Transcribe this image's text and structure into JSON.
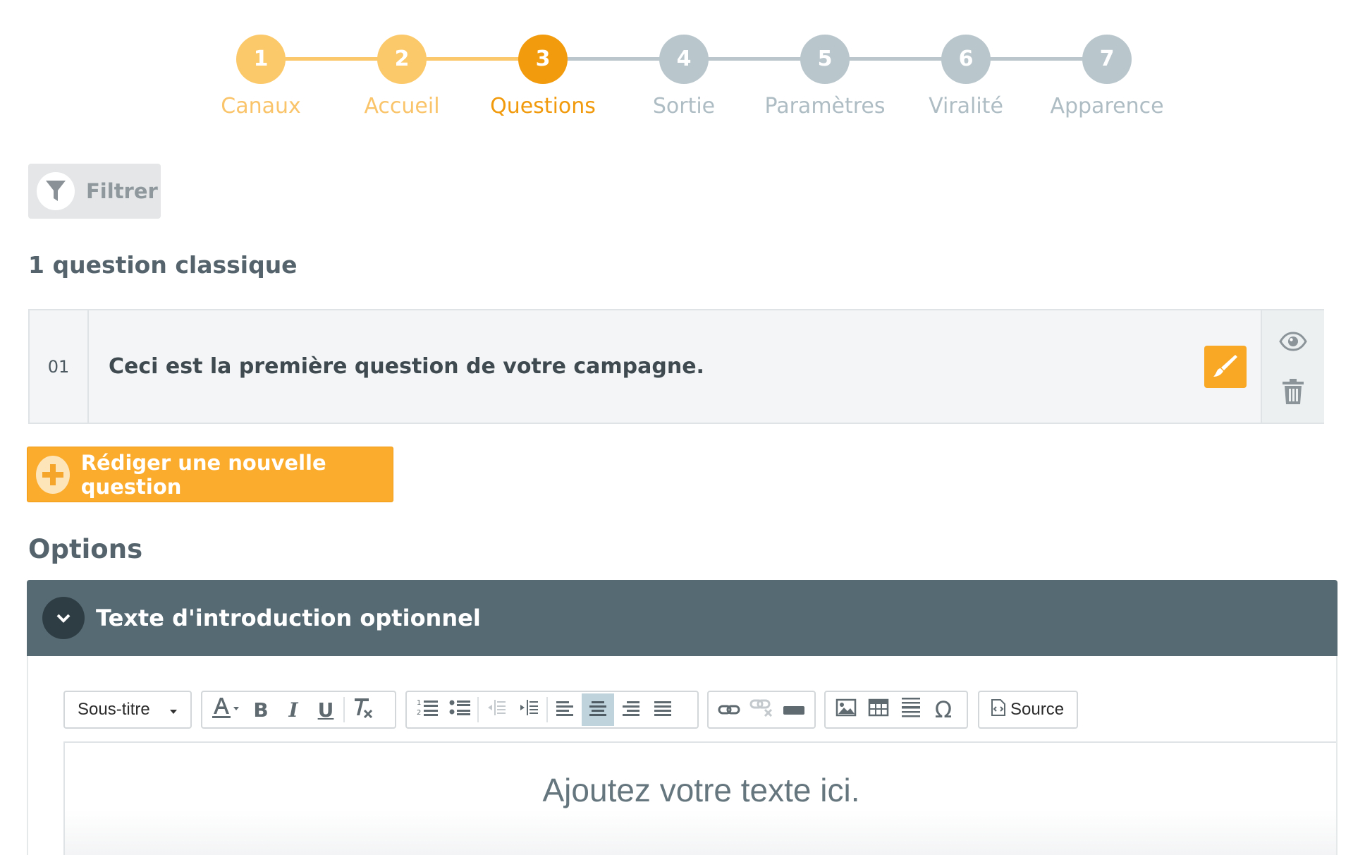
{
  "stepper": {
    "steps": [
      {
        "number": "1",
        "label": "Canaux",
        "state": "done"
      },
      {
        "number": "2",
        "label": "Accueil",
        "state": "done"
      },
      {
        "number": "3",
        "label": "Questions",
        "state": "current"
      },
      {
        "number": "4",
        "label": "Sortie",
        "state": "todo"
      },
      {
        "number": "5",
        "label": "Paramètres",
        "state": "todo"
      },
      {
        "number": "6",
        "label": "Viralité",
        "state": "todo"
      },
      {
        "number": "7",
        "label": "Apparence",
        "state": "todo"
      }
    ],
    "colors": {
      "done_circle": "#fcc96a",
      "done_label": "#f9c46a",
      "current_circle": "#f29b0c",
      "current_label": "#f19a0b",
      "todo_circle": "#b9c6cc",
      "todo_label": "#aebcc3",
      "done_line": "#fbc86b",
      "todo_line": "#bac6cc"
    }
  },
  "filter": {
    "label": "Filtrer",
    "icon": "funnel-icon"
  },
  "questions_section": {
    "title": "1 question classique"
  },
  "questions": [
    {
      "number": "01",
      "text": "Ceci est la première question de votre campagne.",
      "edit_icon": "brush-icon",
      "view_icon": "eye-icon",
      "delete_icon": "trash-icon"
    }
  ],
  "new_question": {
    "label": "Rédiger une nouvelle question",
    "icon": "plus-icon"
  },
  "options": {
    "title": "Options",
    "panel": {
      "title": "Texte d'introduction optionnel",
      "icon": "chevron-down-icon"
    }
  },
  "toolbar": {
    "format_select": "Sous-titre",
    "source_label": "Source"
  },
  "editor": {
    "placeholder": "Ajoutez votre texte ici."
  },
  "theme": {
    "accent": "#fbac2c",
    "panel_header": "#566a73"
  }
}
